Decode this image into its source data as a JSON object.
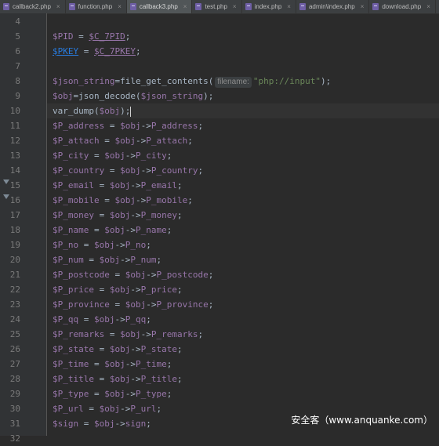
{
  "tabs": [
    {
      "label": "callback2.php",
      "active": false
    },
    {
      "label": "function.php",
      "active": false
    },
    {
      "label": "callback3.php",
      "active": true
    },
    {
      "label": "test.php",
      "active": false
    },
    {
      "label": "index.php",
      "active": false
    },
    {
      "label": "admin\\index.php",
      "active": false
    },
    {
      "label": "download.php",
      "active": false
    }
  ],
  "editor": {
    "line_numbers": [
      "4",
      "5",
      "6",
      "7",
      "8",
      "9",
      "10",
      "11",
      "12",
      "13",
      "14",
      "15",
      "16",
      "17",
      "18",
      "19",
      "20",
      "21",
      "22",
      "23",
      "24",
      "25",
      "26",
      "27",
      "28",
      "29",
      "30",
      "31",
      "32"
    ],
    "lines": {
      "l5": {
        "v1": "$PID",
        "eq": " = ",
        "v2": "$C_7PID",
        "end": ";"
      },
      "l6": {
        "v1": "$PKEY",
        "eq": " = ",
        "v2": "$C_7PKEY",
        "end": ";"
      },
      "l8": {
        "v1": "$json_string",
        "eq": "=",
        "fn": "file_get_contents",
        "open": "(",
        "hint": "filename:",
        "str": "\"php://input\"",
        "close": ");"
      },
      "l9": {
        "v1": "$obj",
        "eq": "=",
        "fn": "json_decode",
        "open": "(",
        "arg": "$json_string",
        "close": ");"
      },
      "l10": {
        "fn": "var_dump",
        "open": "(",
        "arg": "$obj",
        "close": ");"
      },
      "assignments": [
        {
          "var": "$P_address",
          "prop": "P_address"
        },
        {
          "var": "$P_attach",
          "prop": "P_attach"
        },
        {
          "var": "$P_city",
          "prop": "P_city"
        },
        {
          "var": "$P_country",
          "prop": "P_country"
        },
        {
          "var": "$P_email",
          "prop": "P_email"
        },
        {
          "var": "$P_mobile",
          "prop": "P_mobile"
        },
        {
          "var": "$P_money",
          "prop": "P_money"
        },
        {
          "var": "$P_name",
          "prop": "P_name"
        },
        {
          "var": "$P_no",
          "prop": "P_no"
        },
        {
          "var": "$P_num",
          "prop": "P_num"
        },
        {
          "var": "$P_postcode",
          "prop": "P_postcode"
        },
        {
          "var": "$P_price",
          "prop": "P_price"
        },
        {
          "var": "$P_province",
          "prop": "P_province"
        },
        {
          "var": "$P_qq",
          "prop": "P_qq"
        },
        {
          "var": "$P_remarks",
          "prop": "P_remarks"
        },
        {
          "var": "$P_state",
          "prop": "P_state"
        },
        {
          "var": "$P_time",
          "prop": "P_time"
        },
        {
          "var": "$P_title",
          "prop": "P_title"
        },
        {
          "var": "$P_type",
          "prop": "P_type"
        },
        {
          "var": "$P_url",
          "prop": "P_url"
        },
        {
          "var": "$sign",
          "prop": "sign"
        }
      ],
      "op_eq": " = ",
      "obj": "$obj",
      "arrow": "->",
      "end": ";"
    }
  },
  "watermark": "安全客（www.anquanke.com）",
  "colors": {
    "background": "#2b2b2b",
    "variable": "#9876aa",
    "string": "#6a8759",
    "text": "#a9b7c6",
    "line_number": "#7a7a7a",
    "link_variable": "#287bde"
  },
  "icons": {
    "tab_file": "php-file-icon",
    "tab_close": "close-icon",
    "fold": "fold-arrow-icon"
  }
}
